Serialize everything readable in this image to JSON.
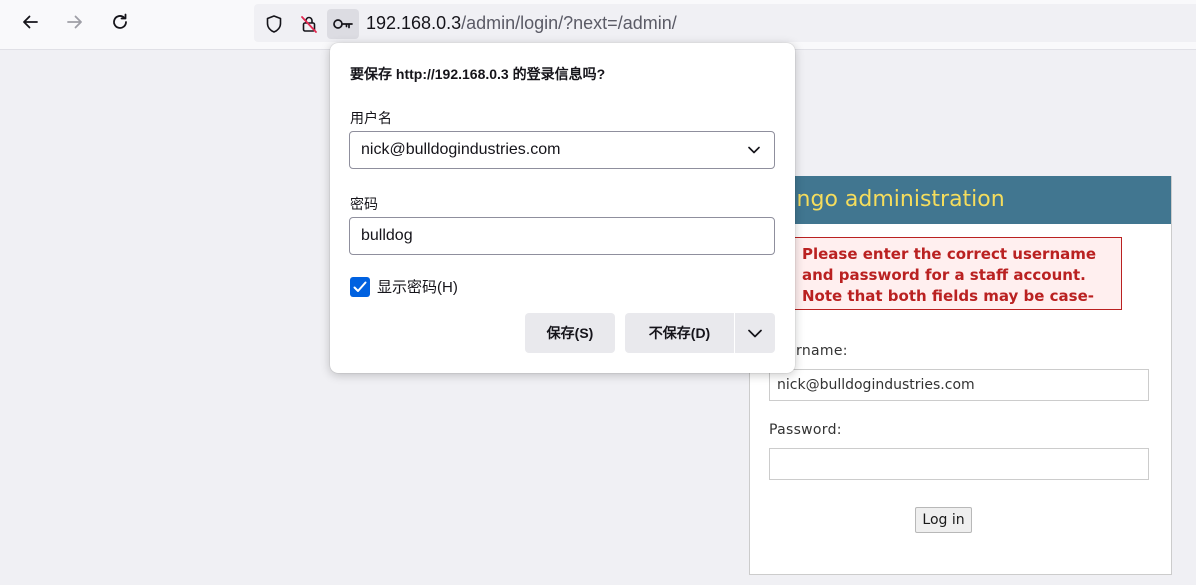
{
  "browser": {
    "url_host": "192.168.0.3",
    "url_path": "/admin/login/?next=/admin/",
    "icons": [
      "back-arrow-icon",
      "forward-arrow-icon",
      "reload-icon",
      "shield-icon",
      "lock-slash-icon",
      "key-icon"
    ]
  },
  "django": {
    "header_title": "Django administration",
    "error_message": "Please enter the correct username and password for a staff account. Note that both fields may be case-sensitive.",
    "username_label": "Username:",
    "username_value": "nick@bulldogindustries.com",
    "password_label": "Password:",
    "password_value": "",
    "submit_label": "Log in",
    "colors": {
      "header_bg": "#417690",
      "header_text": "#f5dd5d",
      "error": "#ba2121"
    }
  },
  "save_login_popup": {
    "title": "要保存 http://192.168.0.3 的登录信息吗?",
    "username_label": "用户名",
    "username_value": "nick@bulldogindustries.com",
    "password_label": "密码",
    "password_value": "bulldog",
    "show_password_label": "显示密码(H)",
    "show_password_checked": true,
    "save_button": "保存(S)",
    "dont_save_button": "不保存(D)",
    "accent_color": "#0061e0"
  }
}
